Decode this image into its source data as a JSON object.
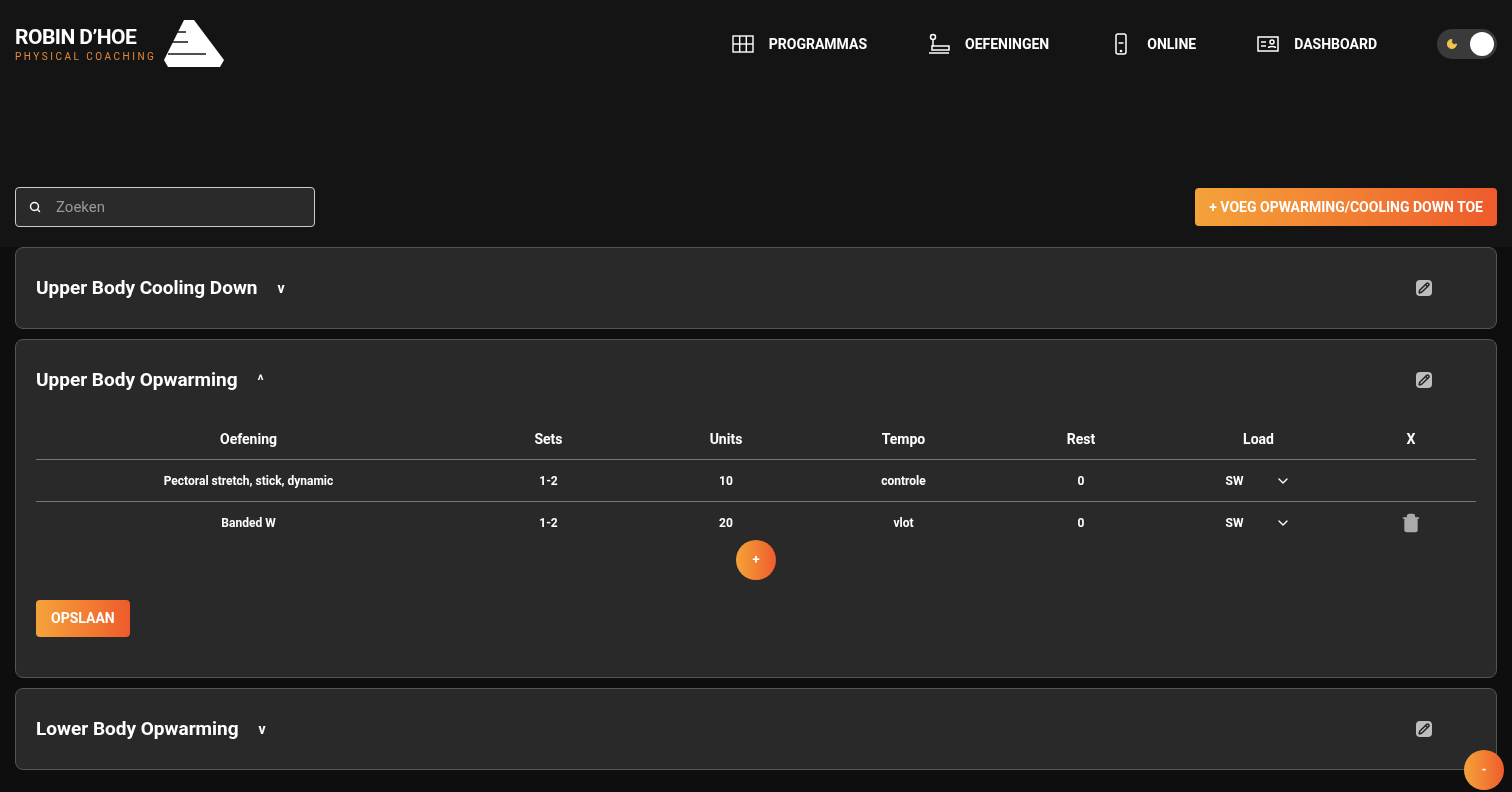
{
  "logo": {
    "name": "ROBIN D’HOE",
    "tagline": "PHYSICAL COACHING"
  },
  "nav": [
    {
      "label": "PROGRAMMAS",
      "kind": "grid"
    },
    {
      "label": "OEFENINGEN",
      "kind": "bench"
    },
    {
      "label": "ONLINE",
      "kind": "phone"
    },
    {
      "label": "DASHBOARD",
      "kind": "card"
    }
  ],
  "dark_mode": true,
  "search": {
    "placeholder": "Zoeken"
  },
  "add_button": "+ VOEG OPWARMING/COOLING DOWN TOE",
  "sections": [
    {
      "title": "Upper Body Cooling Down",
      "toggle": "v",
      "expanded": false
    },
    {
      "title": "Upper Body Opwarming",
      "toggle": "^",
      "expanded": true,
      "columns": [
        "Oefening",
        "Sets",
        "Units",
        "Tempo",
        "Rest",
        "Load",
        "X"
      ],
      "rows": [
        {
          "exercise": "Pectoral stretch, stick, dynamic",
          "sets": "1-2",
          "units": "10",
          "tempo": "controle",
          "rest": "0",
          "load": "SW",
          "deletable": false
        },
        {
          "exercise": "Banded W",
          "sets": "1-2",
          "units": "20",
          "tempo": "vlot",
          "rest": "0",
          "load": "SW",
          "deletable": true
        }
      ],
      "add_row": "+",
      "save": "OPSLAAN"
    },
    {
      "title": "Lower Body Opwarming",
      "toggle": "v",
      "expanded": false
    }
  ],
  "fab": "-"
}
